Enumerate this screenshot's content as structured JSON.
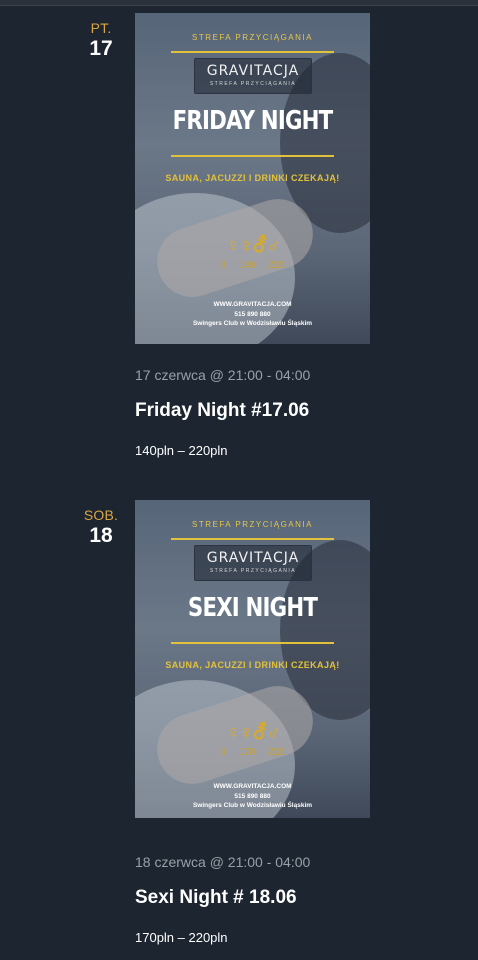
{
  "events": [
    {
      "dow": "PT.",
      "day": "17",
      "poster": {
        "tagline": "STREFA PRZYCIĄGANIA",
        "logo": "GRAVITACJA",
        "logo_sub": "STREFA PRZYCIĄGANIA",
        "headline": "FRIDAY NIGHT",
        "subline": "SAUNA, JACUZZI I DRINKI CZEKAJĄ!",
        "symbols": "♀♀⚦♂",
        "prices": "0 140 220",
        "website": "WWW.GRAVITACJA.COM",
        "phone": "515 890 880",
        "club": "Swingers Club w Wodzisławiu Śląskim"
      },
      "datetime": "17 czerwca @ 21:00 - 04:00",
      "title": "Friday Night #17.06",
      "price": "140pln – 220pln"
    },
    {
      "dow": "SOB.",
      "day": "18",
      "poster": {
        "tagline": "STREFA PRZYCIĄGANIA",
        "logo": "GRAVITACJA",
        "logo_sub": "STREFA PRZYCIĄGANIA",
        "headline": "SEXI NIGHT",
        "subline": "SAUNA, JACUZZI I DRINKI CZEKAJĄ!",
        "symbols": "♀♀⚦♂",
        "prices": "0 170 220",
        "website": "WWW.GRAVITACJA.COM",
        "phone": "515 890 880",
        "club": "Swingers Club w Wodzisławiu Śląskim"
      },
      "datetime": "18 czerwca @ 21:00 - 04:00",
      "title": "Sexi Night # 18.06",
      "price": "170pln – 220pln"
    }
  ],
  "colors": {
    "background": "#1c2530",
    "accent_day": "#d9a642",
    "poster_gold": "#e2c23c",
    "meta_text": "#9aa0a7"
  }
}
